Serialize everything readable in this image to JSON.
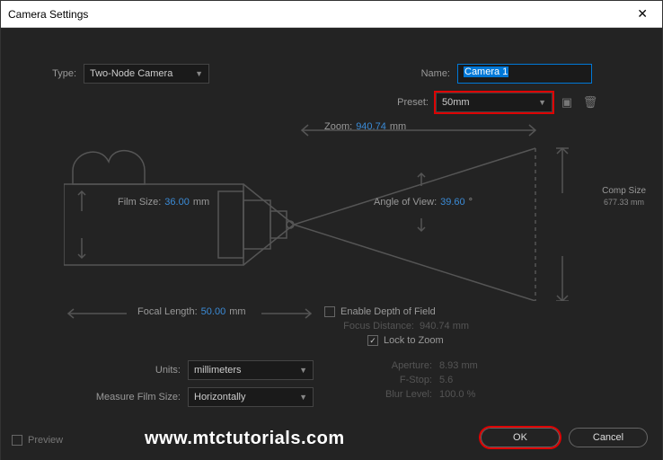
{
  "titlebar": {
    "title": "Camera Settings"
  },
  "labels": {
    "type": "Type:",
    "name": "Name:",
    "preset": "Preset:",
    "zoom": "Zoom:",
    "filmSize": "Film Size:",
    "angle": "Angle of View:",
    "compSize": "Comp Size",
    "focal": "Focal Length:",
    "dof": "Enable Depth of Field",
    "focusDist": "Focus Distance:",
    "lockZoom": "Lock to Zoom",
    "aperture": "Aperture:",
    "fstop": "F-Stop:",
    "blur": "Blur Level:",
    "units": "Units:",
    "measure": "Measure Film Size:",
    "preview": "Preview",
    "ok": "OK",
    "cancel": "Cancel"
  },
  "values": {
    "type": "Two-Node Camera",
    "name": "Camera 1",
    "preset": "50mm",
    "zoom": "940.74",
    "zoomUnit": "mm",
    "filmSize": "36.00",
    "filmSizeUnit": "mm",
    "angle": "39.60",
    "angleUnit": "°",
    "compSize": "677.33 mm",
    "focal": "50.00",
    "focalUnit": "mm",
    "focusDist": "940.74 mm",
    "aperture": "8.93 mm",
    "fstop": "5.6",
    "blur": "100.0 %",
    "units": "millimeters",
    "measure": "Horizontally",
    "lockZoomChecked": "✓"
  },
  "watermark": "www.mtctutorials.com"
}
